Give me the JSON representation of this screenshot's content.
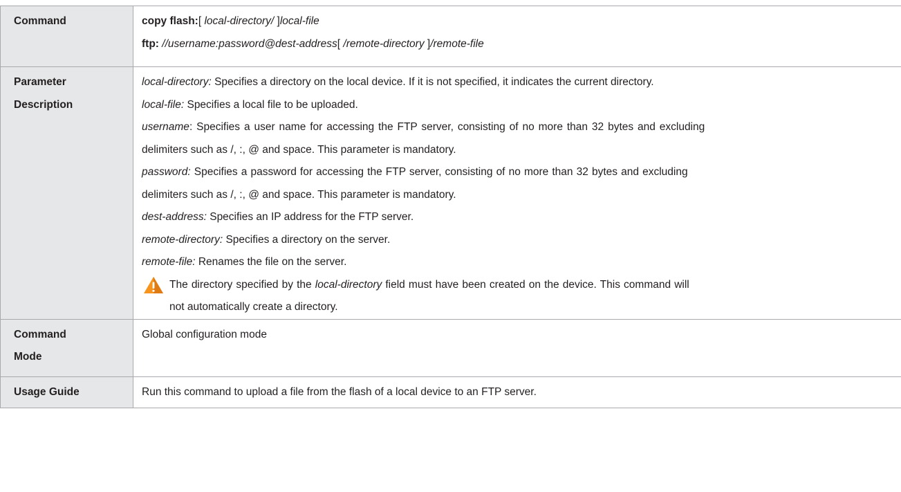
{
  "rows": {
    "command": {
      "label": "Command",
      "line1": {
        "cmd": "copy flash:",
        "b1": "[ ",
        "arg1": "local-directory/",
        "b2": " ]",
        "arg2": "local-file"
      },
      "line2": {
        "cmd": "ftp:",
        "sp": " ",
        "arg1": "//username:password@dest-address",
        "b1": "[ ",
        "arg2": "/remote-directory",
        "b2": " ]",
        "arg3": "/remote-file"
      }
    },
    "parameter": {
      "label_line1": "Parameter",
      "label_line2": "Description",
      "items": [
        {
          "term": "local-directory:",
          "text": " Specifies a directory on the local device. If it is not specified, it indicates the current directory."
        },
        {
          "term": "local-file:",
          "text": " Specifies a local file to be uploaded."
        },
        {
          "term": "username",
          "text": ": Specifies a user name for accessing the FTP server, consisting of no more than 32 bytes and excluding",
          "cont": "delimiters such as /, :, @ and space. This parameter is mandatory."
        },
        {
          "term": "password:",
          "text": " Specifies a password for accessing the FTP server, consisting of no more than 32 bytes and excluding",
          "cont": "delimiters such as /, :, @ and space. This parameter is mandatory."
        },
        {
          "term": "dest-address:",
          "text": " Specifies an IP address for the FTP server."
        },
        {
          "term": "remote-directory:",
          "text": " Specifies a directory on the server."
        },
        {
          "term": "remote-file:",
          "text": " Renames the file on the server."
        }
      ],
      "note": {
        "icon": "warning-icon",
        "pre": "The directory specified by the ",
        "term": "local-directory",
        "post": " field must have been created on the device. This command will",
        "cont": "not automatically create a directory."
      }
    },
    "mode": {
      "label_line1": "Command",
      "label_line2": "Mode",
      "text": "Global configuration mode"
    },
    "usage": {
      "label": "Usage Guide",
      "text": "Run this command to upload a file from the flash of a local device to an FTP server."
    }
  },
  "colors": {
    "label_bg": "#e6e7e8",
    "border": "#a7a9ac",
    "warning": "#f7941d"
  }
}
